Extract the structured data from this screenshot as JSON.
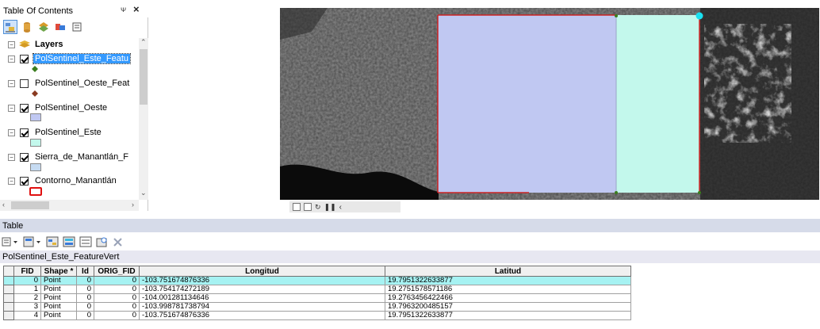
{
  "toc": {
    "title": "Table Of Contents",
    "pin_label": "ᴪ",
    "close_label": "✕",
    "root_label": "Layers",
    "layers": [
      {
        "name": "PolSentinel_Este_Featu",
        "checked": true,
        "highlighted": true,
        "symbol": "point-green"
      },
      {
        "name": "PolSentinel_Oeste_Feat",
        "checked": false,
        "highlighted": false,
        "symbol": "point-brown"
      },
      {
        "name": "PolSentinel_Oeste",
        "checked": true,
        "highlighted": false,
        "symbol": "fill-lavender"
      },
      {
        "name": "PolSentinel_Este",
        "checked": true,
        "highlighted": false,
        "symbol": "fill-mint"
      },
      {
        "name": "Sierra_de_Manantlán_F",
        "checked": true,
        "highlighted": false,
        "symbol": "fill-lightblue"
      },
      {
        "name": "Contorno_Manantlán",
        "checked": true,
        "highlighted": false,
        "symbol": "outline-red"
      }
    ]
  },
  "colors": {
    "lavender_polygon": "#c0c8f2",
    "mint_polygon": "#c3f8ec",
    "polygon_outline": "#cc2222",
    "vertex_green": "#3a7d1e",
    "cyan_vertex": "#19e0f0",
    "selected_row": "#a6f2f2"
  },
  "table": {
    "panel_title": "Table",
    "tab_label": "PolSentinel_Este_FeatureVert",
    "columns": [
      "FID",
      "Shape *",
      "Id",
      "ORIG_FID",
      "Longitud",
      "Latitud"
    ],
    "rows": [
      {
        "fid": "0",
        "shape": "Point",
        "id": "0",
        "orig_fid": "0",
        "longitud": "-103.751674876336",
        "latitud": "19.7951322633877",
        "selected": true
      },
      {
        "fid": "1",
        "shape": "Point",
        "id": "0",
        "orig_fid": "0",
        "longitud": "-103.754174272189",
        "latitud": "19.2751578571186",
        "selected": false
      },
      {
        "fid": "2",
        "shape": "Point",
        "id": "0",
        "orig_fid": "0",
        "longitud": "-104.001281134646",
        "latitud": "19.2763456422466",
        "selected": false
      },
      {
        "fid": "3",
        "shape": "Point",
        "id": "0",
        "orig_fid": "0",
        "longitud": "-103.998781738794",
        "latitud": "19.7963200485157",
        "selected": false
      },
      {
        "fid": "4",
        "shape": "Point",
        "id": "0",
        "orig_fid": "0",
        "longitud": "-103.751674876336",
        "latitud": "19.7951322633877",
        "selected": false
      }
    ]
  }
}
